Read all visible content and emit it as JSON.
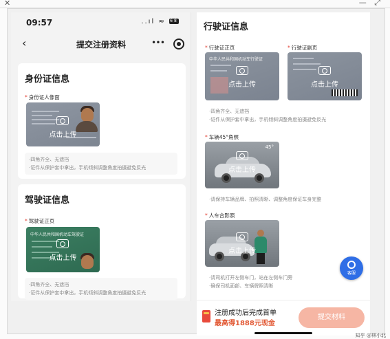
{
  "window": {
    "close_glyph": "✕",
    "controls_glyph": "—  ⤢"
  },
  "status_bar": {
    "time": "09:57",
    "signal": "..ıl",
    "wifi": "≈",
    "battery": "68"
  },
  "navbar": {
    "back": "‹",
    "title": "提交注册资料",
    "more": "•••"
  },
  "id_section": {
    "title": "身份证信息",
    "field_label": "身份证人像面",
    "upload_label": "点击上传",
    "tips": [
      "·四角齐全、无遮挡",
      "·证件从保护套中拿出，手机倾斜调整角度拍摄避免反光"
    ]
  },
  "license_section": {
    "title": "驾驶证信息",
    "field_label": "驾驶证正页",
    "card_header": "中华人民共和国机动车驾驶证",
    "upload_label": "点击上传",
    "tips": [
      "·四角齐全、无遮挡",
      "·证件从保护套中拿出，手机倾斜调整角度拍摄避免反光"
    ]
  },
  "vehicle_section": {
    "title": "行驶证信息",
    "front_label": "行驶证正页",
    "back_label": "行驶证副页",
    "card_header": "中华人民共和国机动车行驶证",
    "upload_label": "点击上传",
    "tips1": "·四角齐全、无遮挡",
    "tips2": "·证件从保护套中拿出，手机倾斜调整角度拍摄避免反光",
    "car45_label": "车辆45°角照",
    "car45_badge": "45°",
    "car45_tip": "·请保持车辆品牌、拍照清晰、调整角度保证车身完整",
    "group_label": "人车合影照",
    "group_tips": [
      "·请司机打开左侧车门，站在左侧车门旁",
      "·确保司机面部、车辆牌照清晰"
    ]
  },
  "bottom_bar": {
    "line1": "注册成功后完成首单",
    "line2": "最高得1888元现金",
    "submit": "提交材料"
  },
  "service_button": {
    "label": "客服"
  },
  "credit": "知乎 @林小北"
}
